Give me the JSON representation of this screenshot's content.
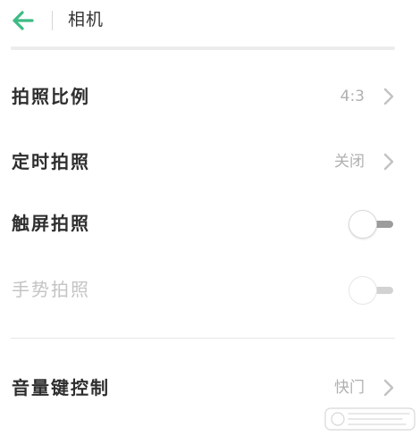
{
  "header": {
    "title": "相机",
    "back_icon": "arrow-left-icon",
    "accent_color": "#3dbb84"
  },
  "settings": [
    {
      "label": "拍照比例",
      "value": "4:3",
      "type": "link"
    },
    {
      "label": "定时拍照",
      "value": "关闭",
      "type": "link"
    },
    {
      "label": "触屏拍照",
      "type": "toggle",
      "on": false,
      "enabled": true
    },
    {
      "label": "手势拍照",
      "type": "toggle",
      "on": false,
      "enabled": false
    }
  ],
  "settings2": [
    {
      "label": "音量键控制",
      "value": "快门",
      "type": "link"
    }
  ],
  "icons": {
    "chevron": "chevron-right-icon"
  }
}
